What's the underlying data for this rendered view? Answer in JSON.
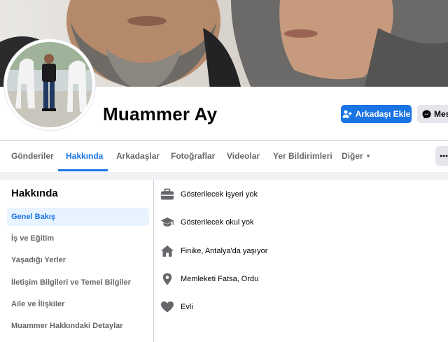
{
  "profile": {
    "name": "Muammer Ay"
  },
  "actions": {
    "add_friend_label": "Arkadaşı Ekle",
    "message_label": "Mes"
  },
  "tabs": [
    {
      "label": "Gönderiler"
    },
    {
      "label": "Hakkında",
      "active": true
    },
    {
      "label": "Arkadaşlar"
    },
    {
      "label": "Fotoğraflar"
    },
    {
      "label": "Videolar"
    },
    {
      "label": "Yer Bildirimleri"
    },
    {
      "label": "Diğer"
    }
  ],
  "more_tab_caret": "▾",
  "about": {
    "title": "Hakkında",
    "sidebar": [
      {
        "label": "Genel Bakış",
        "active": true
      },
      {
        "label": "İş ve Eğitim"
      },
      {
        "label": "Yaşadığı Yerler"
      },
      {
        "label": "İletişim Bilgileri ve Temel Bilgiler"
      },
      {
        "label": "Aile ve İlişkiler"
      },
      {
        "label": "Muammer Hakkındaki Detaylar"
      }
    ],
    "overview": [
      {
        "icon": "briefcase-icon",
        "text": "Gösterilecek işyeri yok"
      },
      {
        "icon": "graduation-cap-icon",
        "text": "Gösterilecek okul yok"
      },
      {
        "icon": "home-icon",
        "text": "Finike, Antalya'da yaşıyor"
      },
      {
        "icon": "location-pin-icon",
        "text": "Memleketi Fatsa, Ordu"
      },
      {
        "icon": "heart-icon",
        "text": "Evli"
      }
    ]
  },
  "colors": {
    "accent": "#1b74e4",
    "active_bg": "#e7f3ff",
    "muted_text": "#65676b",
    "page_bg": "#f0f2f5"
  }
}
